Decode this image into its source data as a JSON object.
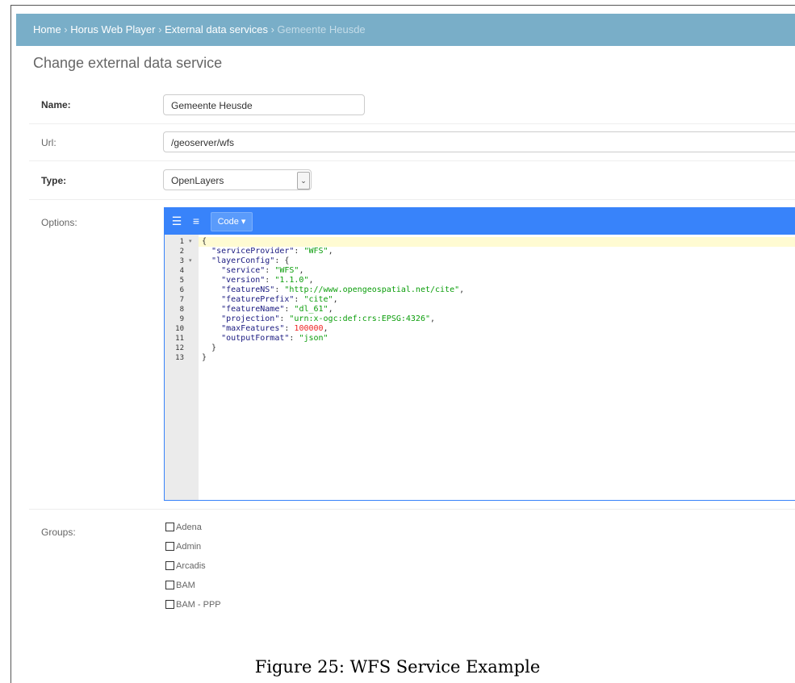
{
  "breadcrumbs": {
    "home": "Home",
    "sep": " › ",
    "horus": "Horus Web Player",
    "external": "External data services",
    "current": "Gemeente Heusde"
  },
  "page_title": "Change external data service",
  "form": {
    "name_label": "Name:",
    "name_value": "Gemeente Heusde",
    "url_label": "Url:",
    "url_value": "/geoserver/wfs",
    "type_label": "Type:",
    "type_value": "OpenLayers",
    "options_label": "Options:",
    "groups_label": "Groups:"
  },
  "editor": {
    "code_button": "Code ▾",
    "lines": [
      {
        "num": "1",
        "fold": "▾",
        "parts": [
          [
            "p",
            "{"
          ]
        ]
      },
      {
        "num": "2",
        "fold": "",
        "parts": [
          [
            "p",
            "  "
          ],
          [
            "k",
            "\"serviceProvider\""
          ],
          [
            "p",
            ": "
          ],
          [
            "s",
            "\"WFS\""
          ],
          [
            "p",
            ","
          ]
        ]
      },
      {
        "num": "3",
        "fold": "▾",
        "parts": [
          [
            "p",
            "  "
          ],
          [
            "k",
            "\"layerConfig\""
          ],
          [
            "p",
            ": {"
          ]
        ]
      },
      {
        "num": "4",
        "fold": "",
        "parts": [
          [
            "p",
            "    "
          ],
          [
            "k",
            "\"service\""
          ],
          [
            "p",
            ": "
          ],
          [
            "s",
            "\"WFS\""
          ],
          [
            "p",
            ","
          ]
        ]
      },
      {
        "num": "5",
        "fold": "",
        "parts": [
          [
            "p",
            "    "
          ],
          [
            "k",
            "\"version\""
          ],
          [
            "p",
            ": "
          ],
          [
            "s",
            "\"1.1.0\""
          ],
          [
            "p",
            ","
          ]
        ]
      },
      {
        "num": "6",
        "fold": "",
        "parts": [
          [
            "p",
            "    "
          ],
          [
            "k",
            "\"featureNS\""
          ],
          [
            "p",
            ": "
          ],
          [
            "s",
            "\"http://www.opengeospatial.net/cite\""
          ],
          [
            "p",
            ","
          ]
        ]
      },
      {
        "num": "7",
        "fold": "",
        "parts": [
          [
            "p",
            "    "
          ],
          [
            "k",
            "\"featurePrefix\""
          ],
          [
            "p",
            ": "
          ],
          [
            "s",
            "\"cite\""
          ],
          [
            "p",
            ","
          ]
        ]
      },
      {
        "num": "8",
        "fold": "",
        "parts": [
          [
            "p",
            "    "
          ],
          [
            "k",
            "\"featureName\""
          ],
          [
            "p",
            ": "
          ],
          [
            "s",
            "\"dl_61\""
          ],
          [
            "p",
            ","
          ]
        ]
      },
      {
        "num": "9",
        "fold": "",
        "parts": [
          [
            "p",
            "    "
          ],
          [
            "k",
            "\"projection\""
          ],
          [
            "p",
            ": "
          ],
          [
            "s",
            "\"urn:x-ogc:def:crs:EPSG:4326\""
          ],
          [
            "p",
            ","
          ]
        ]
      },
      {
        "num": "10",
        "fold": "",
        "parts": [
          [
            "p",
            "    "
          ],
          [
            "k",
            "\"maxFeatures\""
          ],
          [
            "p",
            ": "
          ],
          [
            "n",
            "100000"
          ],
          [
            "p",
            ","
          ]
        ]
      },
      {
        "num": "11",
        "fold": "",
        "parts": [
          [
            "p",
            "    "
          ],
          [
            "k",
            "\"outputFormat\""
          ],
          [
            "p",
            ": "
          ],
          [
            "s",
            "\"json\""
          ]
        ]
      },
      {
        "num": "12",
        "fold": "",
        "parts": [
          [
            "p",
            "  }"
          ]
        ]
      },
      {
        "num": "13",
        "fold": "",
        "parts": [
          [
            "p",
            "}"
          ]
        ]
      }
    ]
  },
  "groups": [
    {
      "label": "Adena",
      "checked": false
    },
    {
      "label": "Admin",
      "checked": false
    },
    {
      "label": "Arcadis",
      "checked": false
    },
    {
      "label": "BAM",
      "checked": false
    },
    {
      "label": "BAM - PPP",
      "checked": false
    }
  ],
  "caption": "Figure 25: WFS Service Example"
}
